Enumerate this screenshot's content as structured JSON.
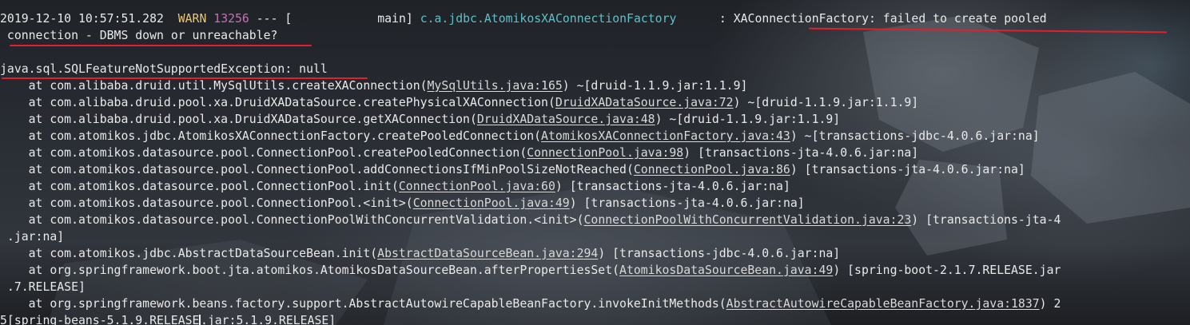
{
  "log_header": {
    "timestamp": "2019-12-10 10:57:51.282",
    "level": "WARN",
    "pid": "13256",
    "separator": "---",
    "thread": "[            main]",
    "logger": "c.a.jdbc.AtomikosXAConnectionFactory",
    "colon": ":",
    "message_part1": "XAConnectionFactory: failed to create pooled",
    "message_part2": "connection - DBMS down or unreachable?"
  },
  "exception": "java.sql.SQLFeatureNotSupportedException: null",
  "stack": [
    {
      "prefix": "    at com.alibaba.druid.util.MySqlUtils.createXAConnection(",
      "link": "MySqlUtils.java:165",
      "suffix": ") ~[druid-1.1.9.jar:1.1.9]"
    },
    {
      "prefix": "    at com.alibaba.druid.pool.xa.DruidXADataSource.createPhysicalXAConnection(",
      "link": "DruidXADataSource.java:72",
      "suffix": ") ~[druid-1.1.9.jar:1.1.9]"
    },
    {
      "prefix": "    at com.alibaba.druid.pool.xa.DruidXADataSource.getXAConnection(",
      "link": "DruidXADataSource.java:48",
      "suffix": ") ~[druid-1.1.9.jar:1.1.9]"
    },
    {
      "prefix": "    at com.atomikos.jdbc.AtomikosXAConnectionFactory.createPooledConnection(",
      "link": "AtomikosXAConnectionFactory.java:43",
      "suffix": ") ~[transactions-jdbc-4.0.6.jar:na]"
    },
    {
      "prefix": "    at com.atomikos.datasource.pool.ConnectionPool.createPooledConnection(",
      "link": "ConnectionPool.java:98",
      "suffix": ") [transactions-jta-4.0.6.jar:na]"
    },
    {
      "prefix": "    at com.atomikos.datasource.pool.ConnectionPool.addConnectionsIfMinPoolSizeNotReached(",
      "link": "ConnectionPool.java:86",
      "suffix": ") [transactions-jta-4.0.6.jar:na]"
    },
    {
      "prefix": "    at com.atomikos.datasource.pool.ConnectionPool.init(",
      "link": "ConnectionPool.java:60",
      "suffix": ") [transactions-jta-4.0.6.jar:na]"
    },
    {
      "prefix": "    at com.atomikos.datasource.pool.ConnectionPool.<init>(",
      "link": "ConnectionPool.java:49",
      "suffix": ") [transactions-jta-4.0.6.jar:na]"
    },
    {
      "prefix": "    at com.atomikos.datasource.pool.ConnectionPoolWithConcurrentValidation.<init>(",
      "link": "ConnectionPoolWithConcurrentValidation.java:23",
      "suffix": ") [transactions-jta-4"
    },
    {
      "prefix": " .jar:na]",
      "link": "",
      "suffix": ""
    },
    {
      "prefix": "    at com.atomikos.jdbc.AbstractDataSourceBean.init(",
      "link": "AbstractDataSourceBean.java:294",
      "suffix": ") [transactions-jdbc-4.0.6.jar:na]"
    },
    {
      "prefix": "    at org.springframework.boot.jta.atomikos.AtomikosDataSourceBean.afterPropertiesSet(",
      "link": "AtomikosDataSourceBean.java:49",
      "suffix": ") [spring-boot-2.1.7.RELEASE.jar"
    },
    {
      "prefix": " .7.RELEASE]",
      "link": "",
      "suffix": ""
    },
    {
      "prefix": "    at org.springframework.beans.factory.support.AbstractAutowireCapableBeanFactory.invokeInitMethods(",
      "link": "AbstractAutowireCapableBeanFactory.java:1837",
      "suffix": ") 2"
    }
  ],
  "last_line_before_cursor": "5[spring-beans-5.1.9.RELEASE",
  "last_line_after_cursor": ".jar:5.1.9.RELEASE]",
  "annotation_color": "#e0202a"
}
